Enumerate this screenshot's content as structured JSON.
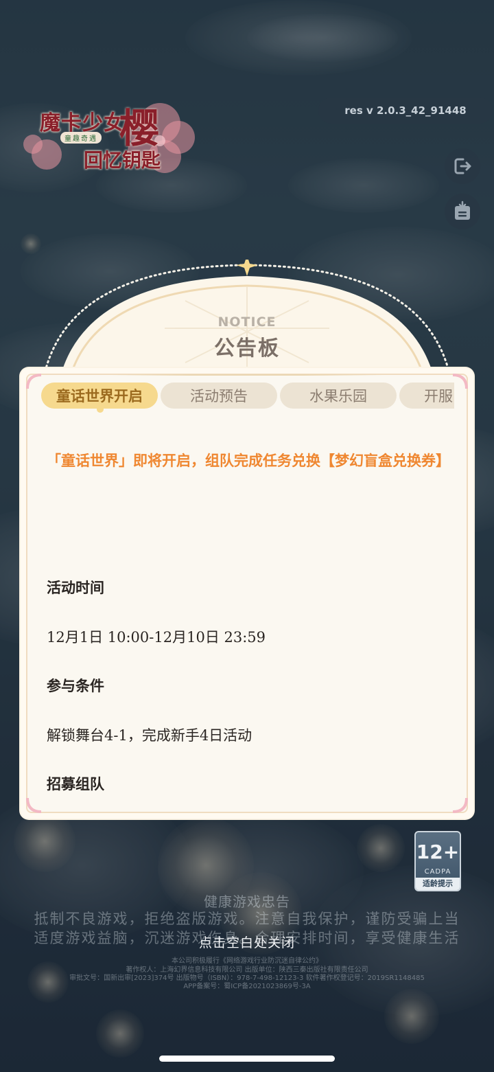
{
  "logo": {
    "line1": "魔卡少女",
    "big_char": "樱",
    "subtitle": "回忆钥匙",
    "tagline": "童趣奇遇"
  },
  "version": "res v 2.0.3_42_91448",
  "side_buttons": {
    "logout_icon": "logout-icon",
    "notice_icon": "notice-board-icon"
  },
  "notice": {
    "label_en": "NOTICE",
    "title": "公告板",
    "tabs": [
      {
        "label": "童话世界开启",
        "active": true
      },
      {
        "label": "活动预告",
        "active": false
      },
      {
        "label": "水果乐园",
        "active": false
      },
      {
        "label": "开服",
        "active": false
      }
    ],
    "headline": "「童话世界」即将开启，组队完成任务兑换【梦幻盲盒兑换券】",
    "sections": [
      {
        "heading": "活动时间",
        "body": "12月1日 10:00-12月10日 23:59"
      },
      {
        "heading": "参与条件",
        "body": "解锁舞台4-1，完成新手4日活动"
      },
      {
        "heading": "招募组队",
        "body": ""
      }
    ]
  },
  "age_rating": {
    "number": "12+",
    "org": "CADPA",
    "label": "适龄提示"
  },
  "health": {
    "title": "健康游戏忠告",
    "line1": "抵制不良游戏，拒绝盗版游戏。注意自我保护，谨防受骗上当",
    "line2": "适度游戏益脑，沉迷游戏伤身。合理安排时间，享受健康生活"
  },
  "close_hint": "点击空白处关闭",
  "fine_print": [
    "本公司积极履行《网络游戏行业防沉迷自律公约》",
    "著作权人：上海幻界信息科技有限公司  出版单位：陕西三秦出版社有限责任公司",
    "审批文号：国新出审[2023]374号  出版物号（ISBN）：978-7-498-12123-3  软件著作权登记号：2019SR1148485",
    "APP备案号：蜀ICP备2021023869号-3A"
  ],
  "colors": {
    "headline": "#ef8731",
    "tab_active": "#f6d98e",
    "tab_inactive": "#ece3d3"
  }
}
